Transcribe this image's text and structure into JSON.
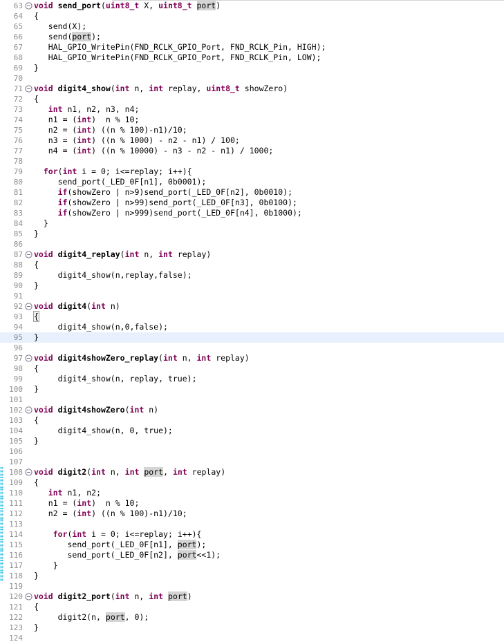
{
  "editor": {
    "name": "code-editor",
    "language": "c",
    "font_size_px": 11.5,
    "line_height_px": 15,
    "colors": {
      "background": "#ffffff",
      "keyword": "#7f0055",
      "function_name": "#000000",
      "line_number": "#8c8c8c",
      "current_line_highlight": "#e8f0fe",
      "occurrence_highlight": "#d4d4d4",
      "change_bar": "#29a6d6",
      "top_rule": "#d4d4d4"
    },
    "first_visible_line": 63,
    "last_visible_line": 124,
    "current_line": 95,
    "occurrence_highlight_word": "port",
    "bracket_match_line": 93,
    "change_bar_lines": [
      108,
      109,
      110,
      111,
      112,
      113,
      114,
      115,
      116,
      117,
      118
    ]
  },
  "lines": [
    {
      "n": 63,
      "fold": true,
      "text": "void send_port(uint8_t X, uint8_t port)"
    },
    {
      "n": 64,
      "fold": false,
      "text": "{"
    },
    {
      "n": 65,
      "fold": false,
      "text": "   send(X);"
    },
    {
      "n": 66,
      "fold": false,
      "text": "   send(port);"
    },
    {
      "n": 67,
      "fold": false,
      "text": "   HAL_GPIO_WritePin(FND_RCLK_GPIO_Port, FND_RCLK_Pin, HIGH);"
    },
    {
      "n": 68,
      "fold": false,
      "text": "   HAL_GPIO_WritePin(FND_RCLK_GPIO_Port, FND_RCLK_Pin, LOW);"
    },
    {
      "n": 69,
      "fold": false,
      "text": "}"
    },
    {
      "n": 70,
      "fold": false,
      "text": ""
    },
    {
      "n": 71,
      "fold": true,
      "text": "void digit4_show(int n, int replay, uint8_t showZero)"
    },
    {
      "n": 72,
      "fold": false,
      "text": "{"
    },
    {
      "n": 73,
      "fold": false,
      "text": "   int n1, n2, n3, n4;"
    },
    {
      "n": 74,
      "fold": false,
      "text": "   n1 = (int)  n % 10;"
    },
    {
      "n": 75,
      "fold": false,
      "text": "   n2 = (int) ((n % 100)-n1)/10;"
    },
    {
      "n": 76,
      "fold": false,
      "text": "   n3 = (int) ((n % 1000) - n2 - n1) / 100;"
    },
    {
      "n": 77,
      "fold": false,
      "text": "   n4 = (int) ((n % 10000) - n3 - n2 - n1) / 1000;"
    },
    {
      "n": 78,
      "fold": false,
      "text": ""
    },
    {
      "n": 79,
      "fold": false,
      "text": "  for(int i = 0; i<=replay; i++){"
    },
    {
      "n": 80,
      "fold": false,
      "text": "     send_port(_LED_0F[n1], 0b0001);"
    },
    {
      "n": 81,
      "fold": false,
      "text": "     if(showZero | n>9)send_port(_LED_0F[n2], 0b0010);"
    },
    {
      "n": 82,
      "fold": false,
      "text": "     if(showZero | n>99)send_port(_LED_0F[n3], 0b0100);"
    },
    {
      "n": 83,
      "fold": false,
      "text": "     if(showZero | n>999)send_port(_LED_0F[n4], 0b1000);"
    },
    {
      "n": 84,
      "fold": false,
      "text": "  }"
    },
    {
      "n": 85,
      "fold": false,
      "text": "}"
    },
    {
      "n": 86,
      "fold": false,
      "text": ""
    },
    {
      "n": 87,
      "fold": true,
      "text": "void digit4_replay(int n, int replay)"
    },
    {
      "n": 88,
      "fold": false,
      "text": "{"
    },
    {
      "n": 89,
      "fold": false,
      "text": "     digit4_show(n,replay,false);"
    },
    {
      "n": 90,
      "fold": false,
      "text": "}"
    },
    {
      "n": 91,
      "fold": false,
      "text": ""
    },
    {
      "n": 92,
      "fold": true,
      "text": "void digit4(int n)"
    },
    {
      "n": 93,
      "fold": false,
      "text": "{"
    },
    {
      "n": 94,
      "fold": false,
      "text": "     digit4_show(n,0,false);"
    },
    {
      "n": 95,
      "fold": false,
      "text": "}"
    },
    {
      "n": 96,
      "fold": false,
      "text": ""
    },
    {
      "n": 97,
      "fold": true,
      "text": "void digit4showZero_replay(int n, int replay)"
    },
    {
      "n": 98,
      "fold": false,
      "text": "{"
    },
    {
      "n": 99,
      "fold": false,
      "text": "     digit4_show(n, replay, true);"
    },
    {
      "n": 100,
      "fold": false,
      "text": "}"
    },
    {
      "n": 101,
      "fold": false,
      "text": ""
    },
    {
      "n": 102,
      "fold": true,
      "text": "void digit4showZero(int n)"
    },
    {
      "n": 103,
      "fold": false,
      "text": "{"
    },
    {
      "n": 104,
      "fold": false,
      "text": "     digit4_show(n, 0, true);"
    },
    {
      "n": 105,
      "fold": false,
      "text": "}"
    },
    {
      "n": 106,
      "fold": false,
      "text": ""
    },
    {
      "n": 107,
      "fold": false,
      "text": ""
    },
    {
      "n": 108,
      "fold": true,
      "text": "void digit2(int n, int port, int replay)"
    },
    {
      "n": 109,
      "fold": false,
      "text": "{"
    },
    {
      "n": 110,
      "fold": false,
      "text": "   int n1, n2;"
    },
    {
      "n": 111,
      "fold": false,
      "text": "   n1 = (int)  n % 10;"
    },
    {
      "n": 112,
      "fold": false,
      "text": "   n2 = (int) ((n % 100)-n1)/10;"
    },
    {
      "n": 113,
      "fold": false,
      "text": ""
    },
    {
      "n": 114,
      "fold": false,
      "text": "    for(int i = 0; i<=replay; i++){"
    },
    {
      "n": 115,
      "fold": false,
      "text": "       send_port(_LED_0F[n1], port);"
    },
    {
      "n": 116,
      "fold": false,
      "text": "       send_port(_LED_0F[n2], port<<1);"
    },
    {
      "n": 117,
      "fold": false,
      "text": "    }"
    },
    {
      "n": 118,
      "fold": false,
      "text": "}"
    },
    {
      "n": 119,
      "fold": false,
      "text": ""
    },
    {
      "n": 120,
      "fold": true,
      "text": "void digit2_port(int n, int port)"
    },
    {
      "n": 121,
      "fold": false,
      "text": "{"
    },
    {
      "n": 122,
      "fold": false,
      "text": "     digit2(n, port, 0);"
    },
    {
      "n": 123,
      "fold": false,
      "text": "}"
    },
    {
      "n": 124,
      "fold": false,
      "text": ""
    }
  ]
}
